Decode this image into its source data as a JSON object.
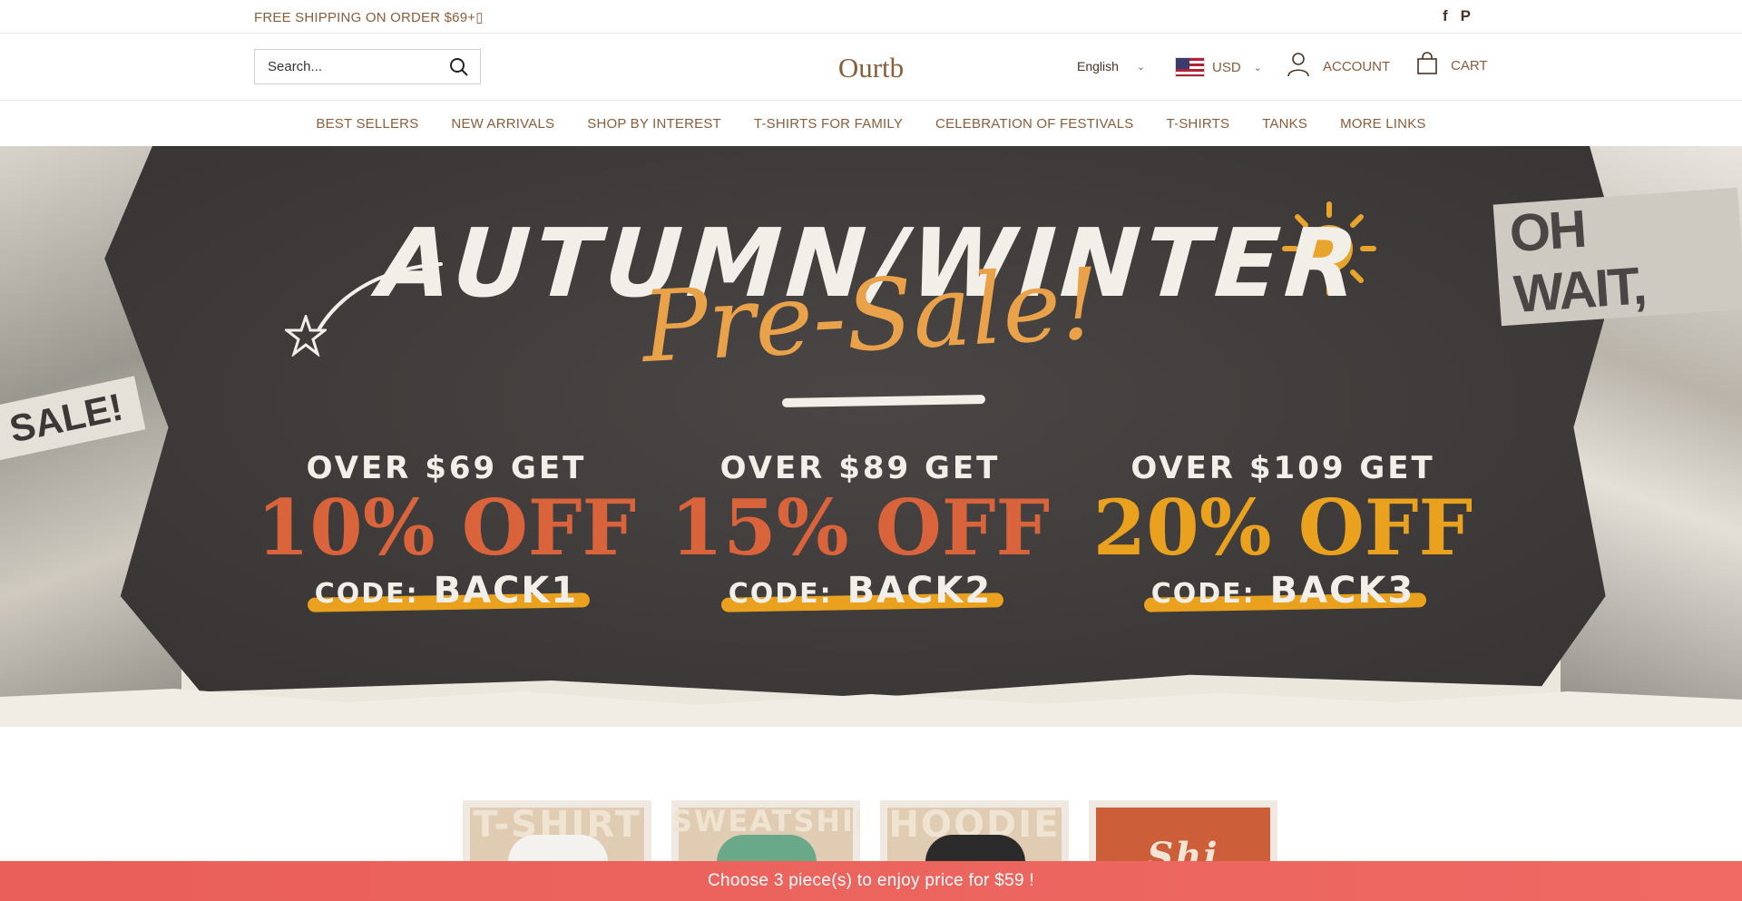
{
  "announcement": {
    "text": "FREE SHIPPING ON ORDER $69+▯",
    "social": [
      "facebook-icon",
      "pinterest-icon"
    ],
    "facebook_glyph": "f",
    "pinterest_glyph": "P"
  },
  "header": {
    "search_placeholder": "Search...",
    "logo": "Ourtb",
    "language": "English",
    "currency": "USD",
    "account_label": "ACCOUNT",
    "cart_label": "CART"
  },
  "nav": {
    "items": [
      "BEST SELLERS",
      "NEW ARRIVALS",
      "SHOP BY INTEREST",
      "T-SHIRTS FOR FAMILY",
      "CELEBRATION OF FESTIVALS",
      "T-SHIRTS",
      "TANKS",
      "MORE LINKS"
    ]
  },
  "hero": {
    "headline": "AUTUMN/WINTER",
    "subheadline": "Pre-Sale!",
    "sale_tag": "SALE!",
    "oh_wait": "OH WAIT,",
    "offers": [
      {
        "threshold": "OVER $69 GET",
        "discount": "10% OFF",
        "code_prefix": "CODE:",
        "code": "BACK1",
        "color": "#d9633a"
      },
      {
        "threshold": "OVER $89 GET",
        "discount": "15% OFF",
        "code_prefix": "CODE:",
        "code": "BACK2",
        "color": "#d9633a"
      },
      {
        "threshold": "OVER $109 GET",
        "discount": "20% OFF",
        "code_prefix": "CODE:",
        "code": "BACK3",
        "color": "#e9a11e"
      }
    ]
  },
  "categories": [
    {
      "label": "T-SHIRT",
      "garment_color": "#f4f2ee"
    },
    {
      "label": "SWEATSHIRT",
      "garment_color": "#6aa88a"
    },
    {
      "label": "HOODIE",
      "garment_color": "#2c2b2b"
    },
    {
      "label": "Shi",
      "garment_color": "#cd5e3a"
    }
  ],
  "promo_bar": {
    "text": "Choose 3 piece(s) to enjoy price for $59 !"
  },
  "colors": {
    "brand_text": "#8a5d3b",
    "promo_bg": "#ea5e59",
    "hero_board": "#3e3b3a",
    "accent_orange": "#d9633a",
    "accent_yellow": "#e9a11e"
  }
}
